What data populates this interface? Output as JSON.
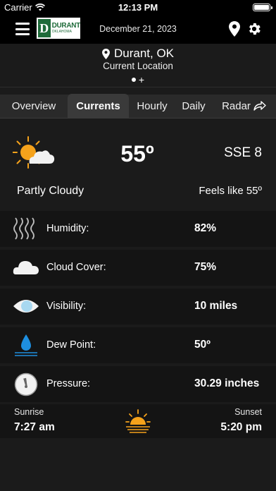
{
  "status_bar": {
    "carrier": "Carrier",
    "time": "12:13 PM"
  },
  "header": {
    "logo_text": "DURANT",
    "logo_subtext": "OKLAHOMA",
    "logo_letter": "D",
    "date": "December 21, 2023"
  },
  "location": {
    "city": "Durant, OK",
    "subtitle": "Current Location"
  },
  "tabs": [
    {
      "label": "Overview",
      "active": false
    },
    {
      "label": "Currents",
      "active": true
    },
    {
      "label": "Hourly",
      "active": false
    },
    {
      "label": "Daily",
      "active": false
    },
    {
      "label": "Radar",
      "active": false
    }
  ],
  "current": {
    "icon": "partly-cloudy-icon",
    "temperature": "55º",
    "wind": "SSE 8",
    "condition": "Partly Cloudy",
    "feels_like": "Feels like 55º"
  },
  "details": [
    {
      "icon": "humidity-icon",
      "label": "Humidity:",
      "value": "82%"
    },
    {
      "icon": "cloud-icon",
      "label": "Cloud Cover:",
      "value": "75%"
    },
    {
      "icon": "eye-icon",
      "label": "Visibility:",
      "value": "10 miles"
    },
    {
      "icon": "water-drop-icon",
      "label": "Dew Point:",
      "value": "50º"
    },
    {
      "icon": "gauge-icon",
      "label": "Pressure:",
      "value": "30.29 inches"
    }
  ],
  "sun": {
    "sunrise_label": "Sunrise",
    "sunrise": "7:27 am",
    "sunset_label": "Sunset",
    "sunset": "5:20 pm"
  },
  "colors": {
    "sun": "#f5a21b",
    "drop": "#1e8fe0",
    "logo_green": "#1f6b3a"
  }
}
